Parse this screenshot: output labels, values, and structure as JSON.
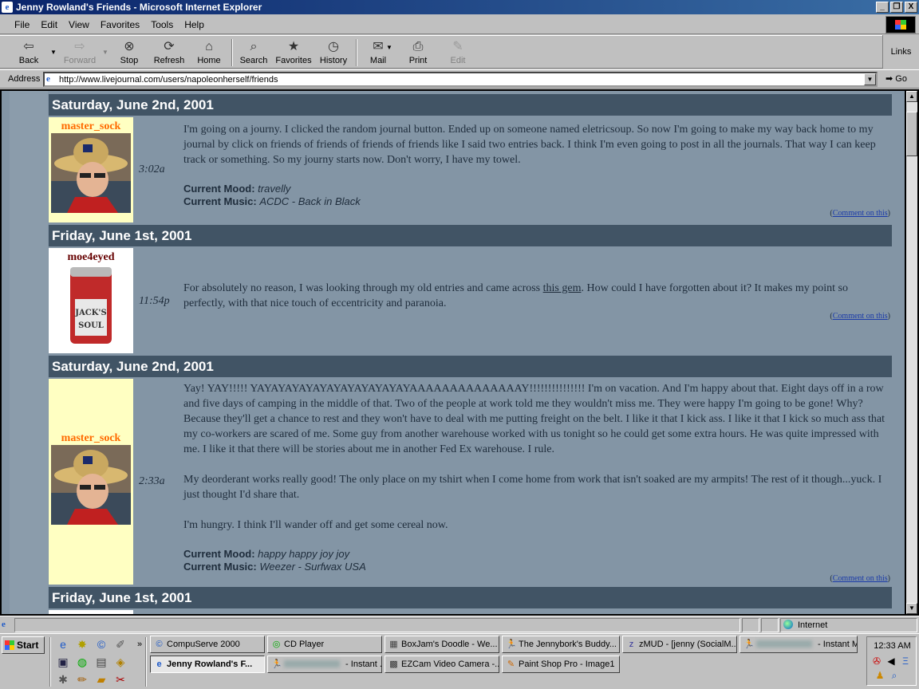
{
  "window": {
    "title": "Jenny Rowland's Friends - Microsoft Internet Explorer",
    "buttons": [
      "_",
      "❐",
      "X"
    ]
  },
  "menubar": {
    "items": [
      "File",
      "Edit",
      "View",
      "Favorites",
      "Tools",
      "Help"
    ]
  },
  "toolbar": {
    "back": "Back",
    "forward": "Forward",
    "stop": "Stop",
    "refresh": "Refresh",
    "home": "Home",
    "search": "Search",
    "favorites": "Favorites",
    "history": "History",
    "mail": "Mail",
    "print": "Print",
    "edit": "Edit",
    "links": "Links"
  },
  "address": {
    "label": "Address",
    "url": "http://www.livejournal.com/users/napoleonherself/friends",
    "go": "Go"
  },
  "entries": [
    {
      "date": "Saturday, June 2nd, 2001",
      "user": "master_sock",
      "time": "3:02a",
      "paragraphs": [
        "I'm going on a journy. I clicked the random journal button. Ended up on someone named eletricsoup. So now I'm going to make my way back home to my journal by click on friends of friends of friends of friends like I said two entries back. I think I'm even going to post in all the journals. That way I can keep track or something. So my journy starts now. Don't worry, I have my towel."
      ],
      "mood_label": "Current Mood:",
      "mood": "travelly",
      "music_label": "Current Music:",
      "music": "ACDC - Back in Black",
      "comment_open": "(",
      "comment": "Comment on this",
      "comment_close": ")"
    },
    {
      "date": "Friday, June 1st, 2001",
      "user": "moe4eyed",
      "time": "11:54p",
      "text_before": "For absolutely no reason, I was looking through my old entries and came across ",
      "link": "this gem",
      "text_after": ". How could I have forgotten about it? It makes my point so perfectly, with that nice touch of eccentricity and paranoia.",
      "comment_open": "(",
      "comment": "Comment on this",
      "comment_close": ")"
    },
    {
      "date": "Saturday, June 2nd, 2001",
      "user": "master_sock",
      "time": "2:33a",
      "paragraphs": [
        "Yay! YAY!!!!! YAYAYAYAYAYAYAYAYAYAYAYAAAAAAAAAAAAAAY!!!!!!!!!!!!!!! I'm on vacation. And I'm happy about that. Eight days off in a row and five days of camping in the middle of that. Two of the people at work told me they wouldn't miss me. They were happy I'm going to be gone! Why? Because they'll get a chance to rest and they won't have to deal with me putting freight on the belt. I like it that I kick ass. I like it that I kick so much ass that my co-workers are scared of me. Some guy from another warehouse worked with us tonight so he could get some extra hours. He was quite impressed with me. I like it that there will be stories about me in another Fed Ex warehouse. I rule.",
        "My deorderant works really good! The only place on my tshirt when I come home from work that isn't soaked are my armpits! The rest of it though...yuck. I just thought I'd share that.",
        "I'm hungry. I think I'll wander off and get some cereal now."
      ],
      "mood_label": "Current Mood:",
      "mood": "happy happy joy joy",
      "music_label": "Current Music:",
      "music": "Weezer - Surfwax USA",
      "comment_open": "(",
      "comment": "Comment on this",
      "comment_close": ")"
    },
    {
      "date": "Friday, June 1st, 2001"
    }
  ],
  "statusbar": {
    "zone": "Internet"
  },
  "taskbar": {
    "start": "Start",
    "tasks_row1": [
      "CompuServe 2000",
      "CD Player",
      "BoxJam's Doodle - We...",
      "The Jennybork's Buddy...",
      "zMUD - [jenny (SocialM...",
      " - Instant Messa..."
    ],
    "tasks_row2": [
      "Jenny Rowland's F...",
      " - Instant ...",
      "EZCam Video Camera -...",
      "Paint Shop Pro - Image1"
    ],
    "clock": "12:33 AM"
  },
  "colors": {
    "page_bg": "#8395a5",
    "date_header_bg": "#415465",
    "userpic_bg_sock": "#ffffc2",
    "username_orange": "#ff6a00",
    "username_dark": "#660000"
  }
}
